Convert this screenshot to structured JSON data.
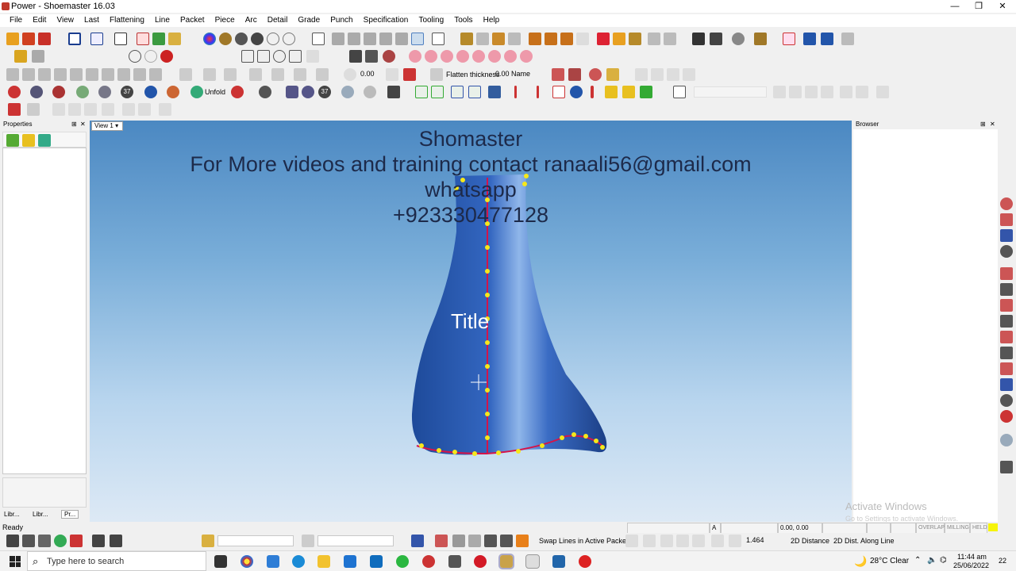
{
  "window": {
    "title": "Power - Shoemaster 16.03",
    "minimize": "—",
    "maximize": "❐",
    "close": "✕"
  },
  "menu": [
    "File",
    "Edit",
    "View",
    "Last",
    "Flattening",
    "Line",
    "Packet",
    "Piece",
    "Arc",
    "Detail",
    "Grade",
    "Punch",
    "Specification",
    "Tooling",
    "Tools",
    "Help"
  ],
  "toolbar": {
    "value_field": "0.00",
    "flatten_label": "Flatten thickness",
    "flatten_value": "0.00 Name",
    "unfold_label": "Unfold",
    "num37a": "37",
    "num37b": "37",
    "num37c": "37"
  },
  "properties": {
    "title": "Properties",
    "pin": "⊞",
    "close": "✕",
    "tabs": [
      "Libr...",
      "Libr...",
      "Pr..."
    ]
  },
  "browser": {
    "title": "Browser",
    "pin": "⊞",
    "close": "✕"
  },
  "view": {
    "tab": "View 1",
    "overlay_line1": "Shomaster",
    "overlay_line2": "For More videos and training contact ranaali56@gmail.com",
    "overlay_line3": "whatsapp",
    "overlay_line4": "+923330477128",
    "model_label": "Title",
    "watermark_title": "Activate Windows",
    "watermark_sub": "Go to Settings to activate Windows."
  },
  "status": {
    "ready": "Ready",
    "field_a": "A",
    "coords": "0.00, 0.00",
    "overlap": "OVERLAP",
    "milling": "MILLING",
    "held": "HELD"
  },
  "bottom_toolbar": {
    "swap_lines": "Swap Lines in Active Packet",
    "value": "1.464",
    "distance_2d": "2D Distance",
    "distance_along": "2D Dist. Along Line"
  },
  "taskbar": {
    "search_placeholder": "Type here to search",
    "weather": "28°C  Clear",
    "time": "11:44 am",
    "date": "25/06/2022",
    "notification_count": "22"
  },
  "colors": {
    "boot": "#2c5fb0",
    "seam": "#d4144a",
    "points": "#f6e81a",
    "overlay_text": "#1d2a4a"
  }
}
